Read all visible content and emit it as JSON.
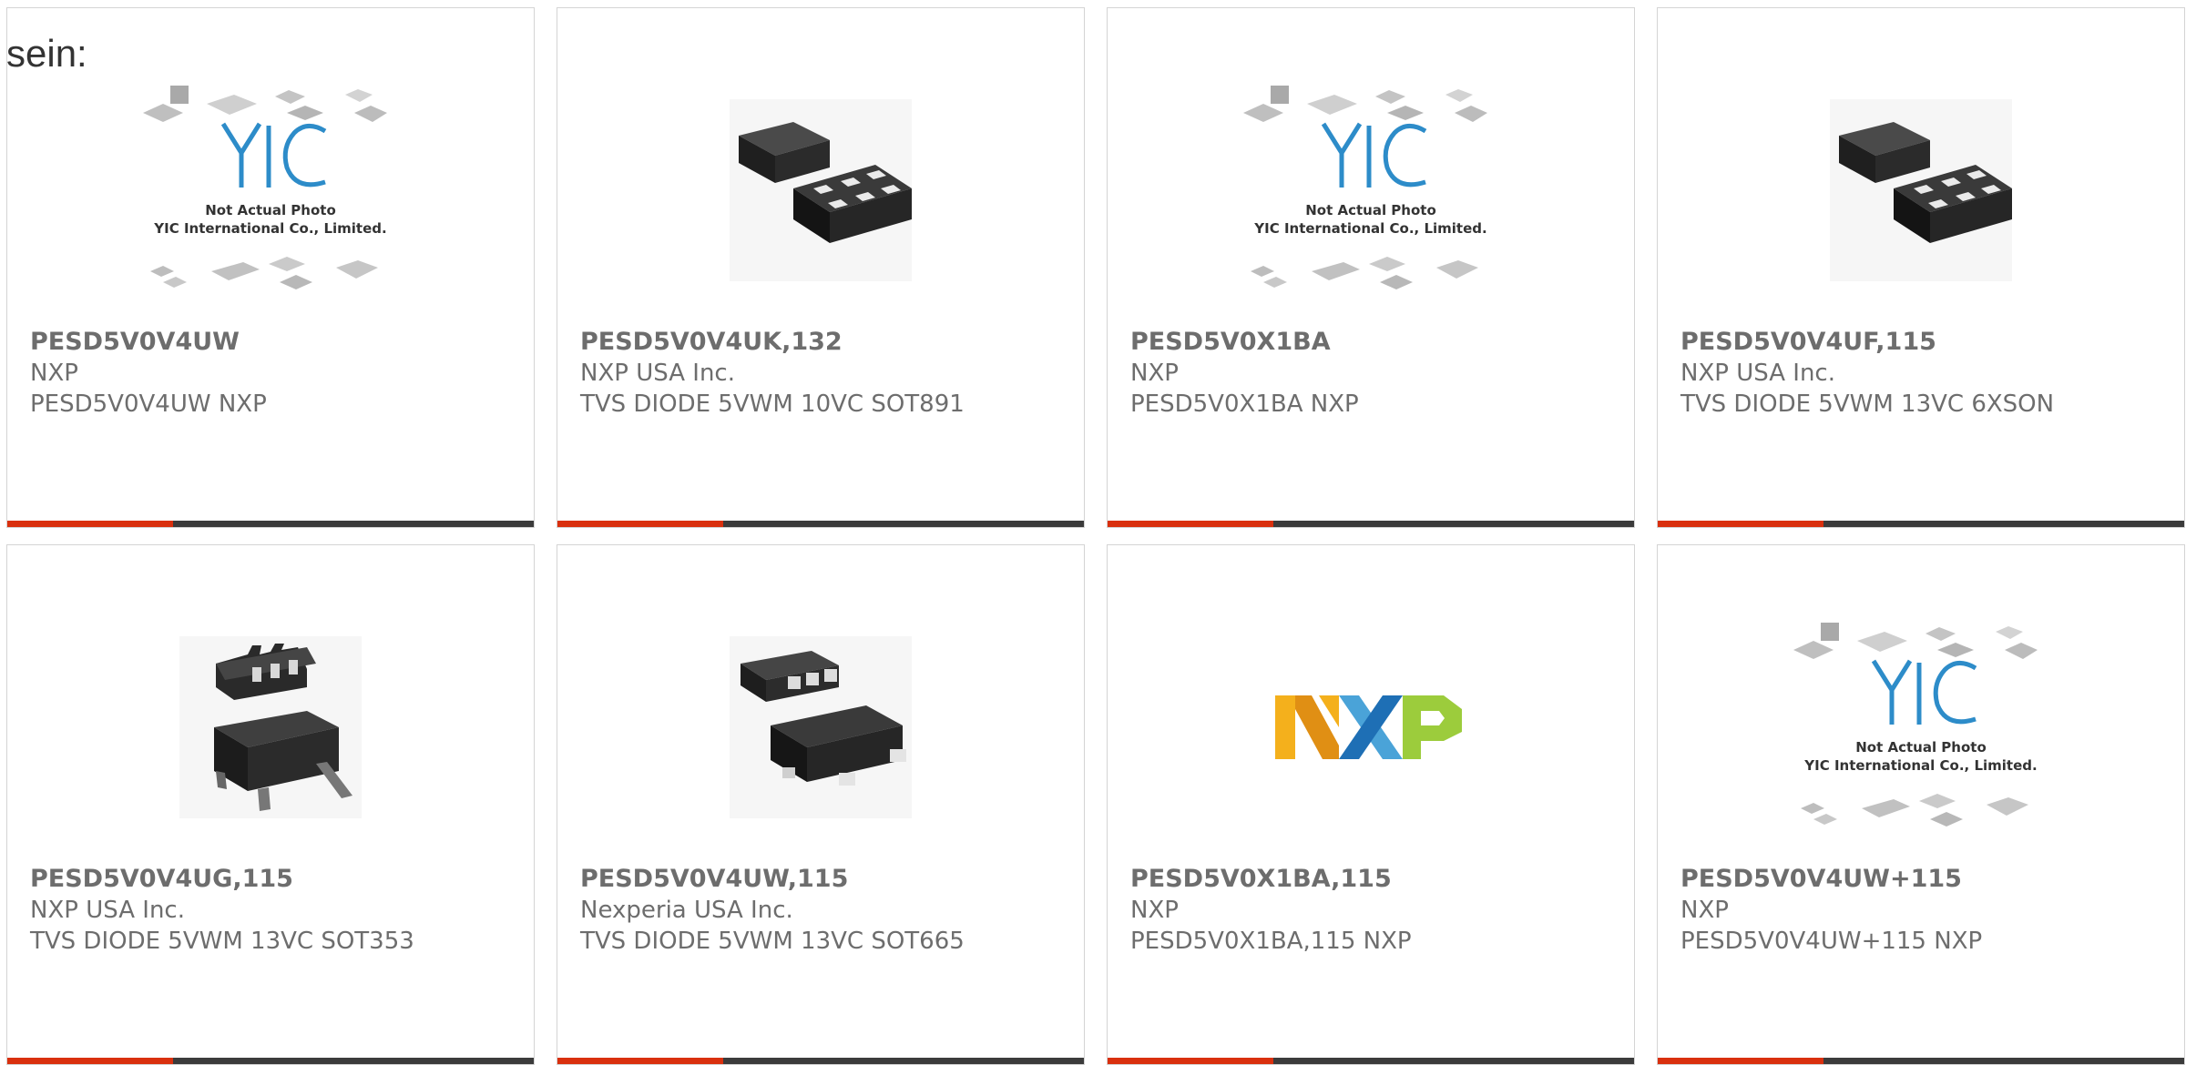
{
  "intro_text": "sein:",
  "placeholder_photo": {
    "brand": "YIC",
    "line1": "Not Actual Photo",
    "line2": "YIC International Co., Limited."
  },
  "nxp_logo_letters": [
    "N",
    "X",
    "P"
  ],
  "colors": {
    "accent": "#d9300e",
    "bar": "#3b3b3b",
    "text": "#6d6d6d",
    "border": "#d4d4d4",
    "yic_blue": "#2d8cc9"
  },
  "products": [
    {
      "part": "PESD5V0V4UW",
      "mfr": "NXP",
      "desc": "PESD5V0V4UW NXP",
      "image": "yic-placeholder"
    },
    {
      "part": "PESD5V0V4UK,132",
      "mfr": "NXP USA Inc.",
      "desc": "TVS DIODE 5VWM 10VC SOT891",
      "image": "chip-6pad"
    },
    {
      "part": "PESD5V0X1BA",
      "mfr": "NXP",
      "desc": "PESD5V0X1BA NXP",
      "image": "yic-placeholder"
    },
    {
      "part": "PESD5V0V4UF,115",
      "mfr": "NXP USA Inc.",
      "desc": "TVS DIODE 5VWM 13VC 6XSON",
      "image": "chip-6pad"
    },
    {
      "part": "PESD5V0V4UG,115",
      "mfr": "NXP USA Inc.",
      "desc": "TVS DIODE 5VWM 13VC SOT353",
      "image": "chip-sot353"
    },
    {
      "part": "PESD5V0V4UW,115",
      "mfr": "Nexperia USA Inc.",
      "desc": "TVS DIODE 5VWM 13VC SOT665",
      "image": "chip-sot665"
    },
    {
      "part": "PESD5V0X1BA,115",
      "mfr": "NXP",
      "desc": "PESD5V0X1BA,115 NXP",
      "image": "nxp-logo"
    },
    {
      "part": "PESD5V0V4UW+115",
      "mfr": "NXP",
      "desc": "PESD5V0V4UW+115 NXP",
      "image": "yic-placeholder"
    }
  ]
}
